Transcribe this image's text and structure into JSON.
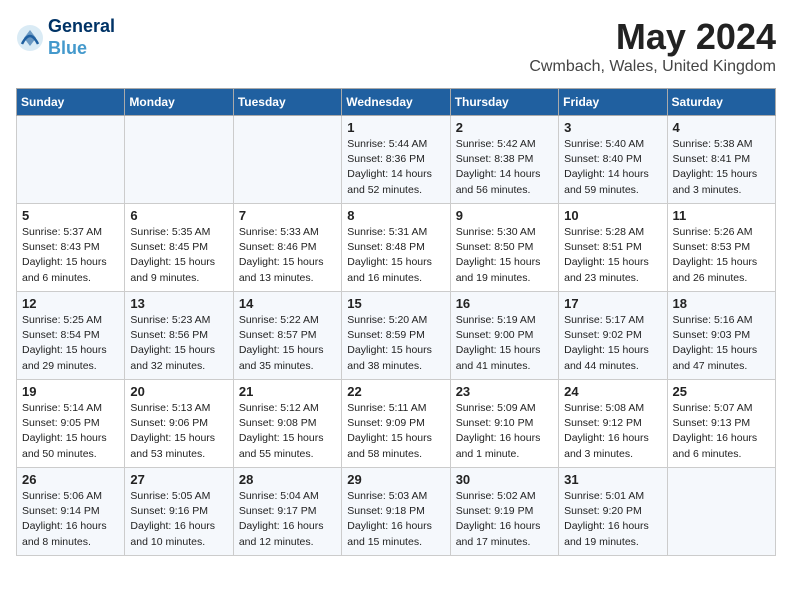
{
  "header": {
    "logo_line1": "General",
    "logo_line2": "Blue",
    "title": "May 2024",
    "location": "Cwmbach, Wales, United Kingdom"
  },
  "weekdays": [
    "Sunday",
    "Monday",
    "Tuesday",
    "Wednesday",
    "Thursday",
    "Friday",
    "Saturday"
  ],
  "weeks": [
    [
      {
        "day": "",
        "content": ""
      },
      {
        "day": "",
        "content": ""
      },
      {
        "day": "",
        "content": ""
      },
      {
        "day": "1",
        "content": "Sunrise: 5:44 AM\nSunset: 8:36 PM\nDaylight: 14 hours\nand 52 minutes."
      },
      {
        "day": "2",
        "content": "Sunrise: 5:42 AM\nSunset: 8:38 PM\nDaylight: 14 hours\nand 56 minutes."
      },
      {
        "day": "3",
        "content": "Sunrise: 5:40 AM\nSunset: 8:40 PM\nDaylight: 14 hours\nand 59 minutes."
      },
      {
        "day": "4",
        "content": "Sunrise: 5:38 AM\nSunset: 8:41 PM\nDaylight: 15 hours\nand 3 minutes."
      }
    ],
    [
      {
        "day": "5",
        "content": "Sunrise: 5:37 AM\nSunset: 8:43 PM\nDaylight: 15 hours\nand 6 minutes."
      },
      {
        "day": "6",
        "content": "Sunrise: 5:35 AM\nSunset: 8:45 PM\nDaylight: 15 hours\nand 9 minutes."
      },
      {
        "day": "7",
        "content": "Sunrise: 5:33 AM\nSunset: 8:46 PM\nDaylight: 15 hours\nand 13 minutes."
      },
      {
        "day": "8",
        "content": "Sunrise: 5:31 AM\nSunset: 8:48 PM\nDaylight: 15 hours\nand 16 minutes."
      },
      {
        "day": "9",
        "content": "Sunrise: 5:30 AM\nSunset: 8:50 PM\nDaylight: 15 hours\nand 19 minutes."
      },
      {
        "day": "10",
        "content": "Sunrise: 5:28 AM\nSunset: 8:51 PM\nDaylight: 15 hours\nand 23 minutes."
      },
      {
        "day": "11",
        "content": "Sunrise: 5:26 AM\nSunset: 8:53 PM\nDaylight: 15 hours\nand 26 minutes."
      }
    ],
    [
      {
        "day": "12",
        "content": "Sunrise: 5:25 AM\nSunset: 8:54 PM\nDaylight: 15 hours\nand 29 minutes."
      },
      {
        "day": "13",
        "content": "Sunrise: 5:23 AM\nSunset: 8:56 PM\nDaylight: 15 hours\nand 32 minutes."
      },
      {
        "day": "14",
        "content": "Sunrise: 5:22 AM\nSunset: 8:57 PM\nDaylight: 15 hours\nand 35 minutes."
      },
      {
        "day": "15",
        "content": "Sunrise: 5:20 AM\nSunset: 8:59 PM\nDaylight: 15 hours\nand 38 minutes."
      },
      {
        "day": "16",
        "content": "Sunrise: 5:19 AM\nSunset: 9:00 PM\nDaylight: 15 hours\nand 41 minutes."
      },
      {
        "day": "17",
        "content": "Sunrise: 5:17 AM\nSunset: 9:02 PM\nDaylight: 15 hours\nand 44 minutes."
      },
      {
        "day": "18",
        "content": "Sunrise: 5:16 AM\nSunset: 9:03 PM\nDaylight: 15 hours\nand 47 minutes."
      }
    ],
    [
      {
        "day": "19",
        "content": "Sunrise: 5:14 AM\nSunset: 9:05 PM\nDaylight: 15 hours\nand 50 minutes."
      },
      {
        "day": "20",
        "content": "Sunrise: 5:13 AM\nSunset: 9:06 PM\nDaylight: 15 hours\nand 53 minutes."
      },
      {
        "day": "21",
        "content": "Sunrise: 5:12 AM\nSunset: 9:08 PM\nDaylight: 15 hours\nand 55 minutes."
      },
      {
        "day": "22",
        "content": "Sunrise: 5:11 AM\nSunset: 9:09 PM\nDaylight: 15 hours\nand 58 minutes."
      },
      {
        "day": "23",
        "content": "Sunrise: 5:09 AM\nSunset: 9:10 PM\nDaylight: 16 hours\nand 1 minute."
      },
      {
        "day": "24",
        "content": "Sunrise: 5:08 AM\nSunset: 9:12 PM\nDaylight: 16 hours\nand 3 minutes."
      },
      {
        "day": "25",
        "content": "Sunrise: 5:07 AM\nSunset: 9:13 PM\nDaylight: 16 hours\nand 6 minutes."
      }
    ],
    [
      {
        "day": "26",
        "content": "Sunrise: 5:06 AM\nSunset: 9:14 PM\nDaylight: 16 hours\nand 8 minutes."
      },
      {
        "day": "27",
        "content": "Sunrise: 5:05 AM\nSunset: 9:16 PM\nDaylight: 16 hours\nand 10 minutes."
      },
      {
        "day": "28",
        "content": "Sunrise: 5:04 AM\nSunset: 9:17 PM\nDaylight: 16 hours\nand 12 minutes."
      },
      {
        "day": "29",
        "content": "Sunrise: 5:03 AM\nSunset: 9:18 PM\nDaylight: 16 hours\nand 15 minutes."
      },
      {
        "day": "30",
        "content": "Sunrise: 5:02 AM\nSunset: 9:19 PM\nDaylight: 16 hours\nand 17 minutes."
      },
      {
        "day": "31",
        "content": "Sunrise: 5:01 AM\nSunset: 9:20 PM\nDaylight: 16 hours\nand 19 minutes."
      },
      {
        "day": "",
        "content": ""
      }
    ]
  ]
}
